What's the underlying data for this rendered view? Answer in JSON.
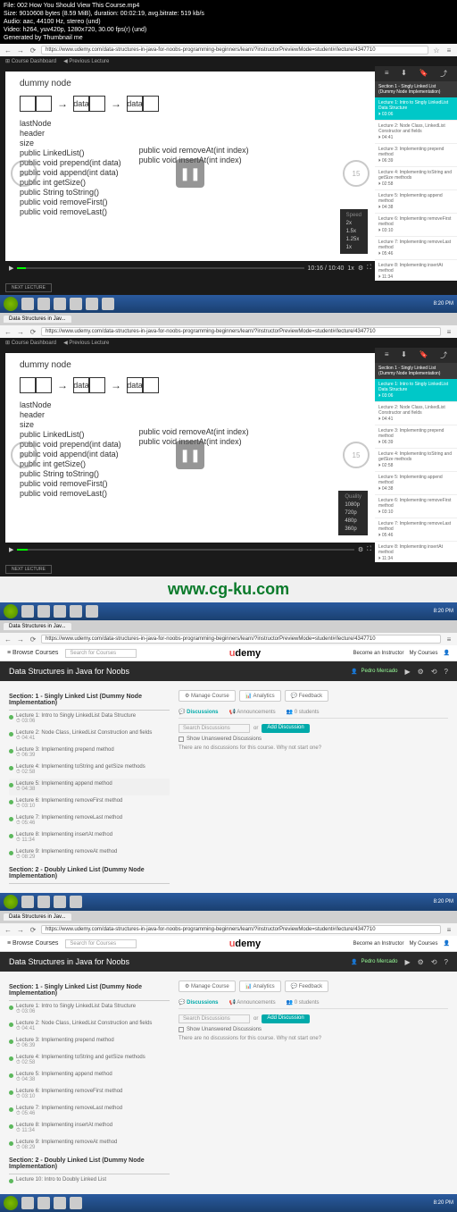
{
  "meta": {
    "l1": "File: 002 How You Should View This Course.mp4",
    "l2": "Size: 9010608 bytes (8.59 MiB), duration: 00:02:19, avg.bitrate: 519 kb/s",
    "l3": "Audio: aac, 44100 Hz, stereo (und)",
    "l4": "Video: h264, yuv420p, 1280x720, 30.00 fps(r) (und)",
    "l5": "Generated by Thumbnail me"
  },
  "browser": {
    "tab": "Data Structures in Jav...",
    "url": "https://www.udemy.com/data-structures-in-java-for-noobs-programming-beginners/learn/?instructorPreviewMode=student#/lecture/4347710"
  },
  "darkbar": {
    "dashboard": "⊞ Course Dashboard",
    "prev": "◀ Previous Lecture"
  },
  "slide": {
    "title": "dummy node",
    "d1": "data",
    "d2": "data",
    "left": [
      "lastNode",
      "header",
      "size",
      "public LinkedList()",
      "public void prepend(int data)",
      "public void append(int data)",
      "public int getSize()",
      "public String toString()",
      "public void removeFirst()",
      "public void removeLast()"
    ],
    "right": [
      "public void removeAt(int index)",
      "public void insertAt(int index)"
    ]
  },
  "speed": {
    "hdr": "Speed",
    "o1": "2x",
    "o2": "1.5x",
    "o3": "1.25x",
    "o4": "1x"
  },
  "quality": {
    "hdr": "Quality",
    "o1": "1080p",
    "o2": "720p",
    "o3": "480p",
    "o4": "360p"
  },
  "controls": {
    "time": "10:16 / 10:40"
  },
  "sidebar": {
    "section": "Section 1 - Singly Linked List (Dummy Node Implementation)",
    "items": [
      {
        "t": "Lecture 1: Intro to Singly LinkedList Data Structure",
        "d": "⏵ 03:06"
      },
      {
        "t": "Lecture 2: Node Class, LinkedList Constructor and fields",
        "d": "⏵ 04:41"
      },
      {
        "t": "Lecture 3: Implementing prepend method",
        "d": "⏵ 06:39"
      },
      {
        "t": "Lecture 4: Implementing toString and getSize methods",
        "d": "⏵ 02:58"
      },
      {
        "t": "Lecture 5: Implementing append method",
        "d": "⏵ 04:38"
      },
      {
        "t": "Lecture 6: Implementing removeFirst method",
        "d": "⏵ 03:10"
      },
      {
        "t": "Lecture 7: Implementing removeLast method",
        "d": "⏵ 05:46"
      },
      {
        "t": "Lecture 8: Implementing insertAt method",
        "d": "⏵ 11:34"
      },
      {
        "t": "Lecture 9: Implementing removeAt method",
        "d": "⏵ 08:29"
      }
    ]
  },
  "nextlec": "NEXT LECTURE",
  "watermark": "www.cg-ku.com",
  "udemy": {
    "browse": "≡ Browse Courses",
    "search": "Search for Courses",
    "logo": "udemy",
    "instructor": "Become an Instructor",
    "mycourses": "My Courses",
    "title": "Data Structures in Java for Noobs",
    "user": "Pedro Mercado",
    "section1": "Section: 1 - Singly Linked List (Dummy Node Implementation)",
    "section2": "Section: 2 - Doubly Linked List (Dummy Node Implementation)",
    "lectures": [
      {
        "t": "Lecture 1: Intro to Singly LinkedList Data Structure",
        "d": "⏱ 03:06"
      },
      {
        "t": "Lecture 2: Node Class, LinkedList Construction and fields",
        "d": "⏱ 04:41"
      },
      {
        "t": "Lecture 3: Implementing prepend method",
        "d": "⏱ 06:39"
      },
      {
        "t": "Lecture 4: Implementing toString and getSize methods",
        "d": "⏱ 02:58"
      },
      {
        "t": "Lecture 5: Implementing append method",
        "d": "⏱ 04:38"
      },
      {
        "t": "Lecture 6: Implementing removeFirst method",
        "d": "⏱ 03:10"
      },
      {
        "t": "Lecture 7: Implementing removeLast method",
        "d": "⏱ 05:46"
      },
      {
        "t": "Lecture 8: Implementing insertAt method",
        "d": "⏱ 11:34"
      },
      {
        "t": "Lecture 9: Implementing removeAt method",
        "d": "⏱ 08:29"
      }
    ],
    "section2lec": "Lecture 10: Intro to Doubly Linked List",
    "mgmt": {
      "manage": "⚙ Manage Course",
      "analytics": "📊 Analytics",
      "feedback": "💬 Feedback"
    },
    "tabs": {
      "disc": "💬 Discussions",
      "ann": "📢 Announcements",
      "students": "👥 0 students"
    },
    "discSearch": "Search Discussions",
    "discOr": "or",
    "addDisc": "Add Discussion",
    "chk": "Show Unanswered Discussions",
    "empty": "There are no discussions for this course. Why not start one?"
  },
  "tray": {
    "time": "8:20 PM"
  }
}
